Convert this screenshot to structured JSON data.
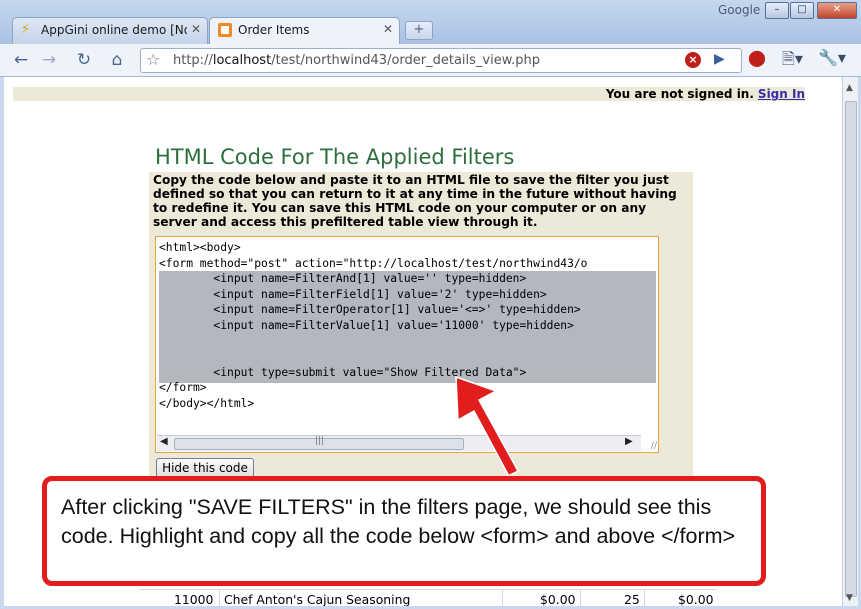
{
  "browser": {
    "brand_label": "Google",
    "tabs": [
      {
        "title": "AppGini online demo [North...",
        "active": false
      },
      {
        "title": "Order Items",
        "active": true
      }
    ],
    "url_prefix": "http://",
    "url_host": "localhost",
    "url_path": "/test/northwind43/order_details_view.php"
  },
  "page": {
    "signin_text": "You are not signed in.",
    "signin_link": "Sign In",
    "title": "HTML Code For The Applied Filters",
    "instructions": "Copy the code below and paste it to an HTML file to save the filter you just defined so that you can return to it at any time in the future without having to redefine it. You can save this HTML code on your computer or on any server and access this prefiltered table view through it.",
    "code_lines": [
      "<html><body>",
      "<form method=\"post\" action=\"http://localhost/test/northwind43/o",
      "        <input name=FilterAnd[1] value='' type=hidden>",
      "        <input name=FilterField[1] value='2' type=hidden>",
      "        <input name=FilterOperator[1] value='<=>' type=hidden>",
      "        <input name=FilterValue[1] value='11000' type=hidden>",
      "",
      "",
      "        <input type=submit value=\"Show Filtered Data\">",
      "</form>",
      "</body></html>"
    ],
    "hide_button": "Hide this code",
    "table_row": {
      "order_id": "11000",
      "product": "Chef Anton's Cajun Seasoning",
      "unit_price": "$0.00",
      "quantity": "25",
      "discount": "$0.00"
    }
  },
  "annotation": {
    "text": "After clicking \"SAVE FILTERS\" in the filters page, we should see this code. Highlight and copy all the code below <form> and above </form>",
    "color": "#e21d1d"
  },
  "colors": {
    "title_green": "#2e6e3e",
    "panel_bg": "#ece9d8",
    "highlight": "#b4b7c0"
  }
}
